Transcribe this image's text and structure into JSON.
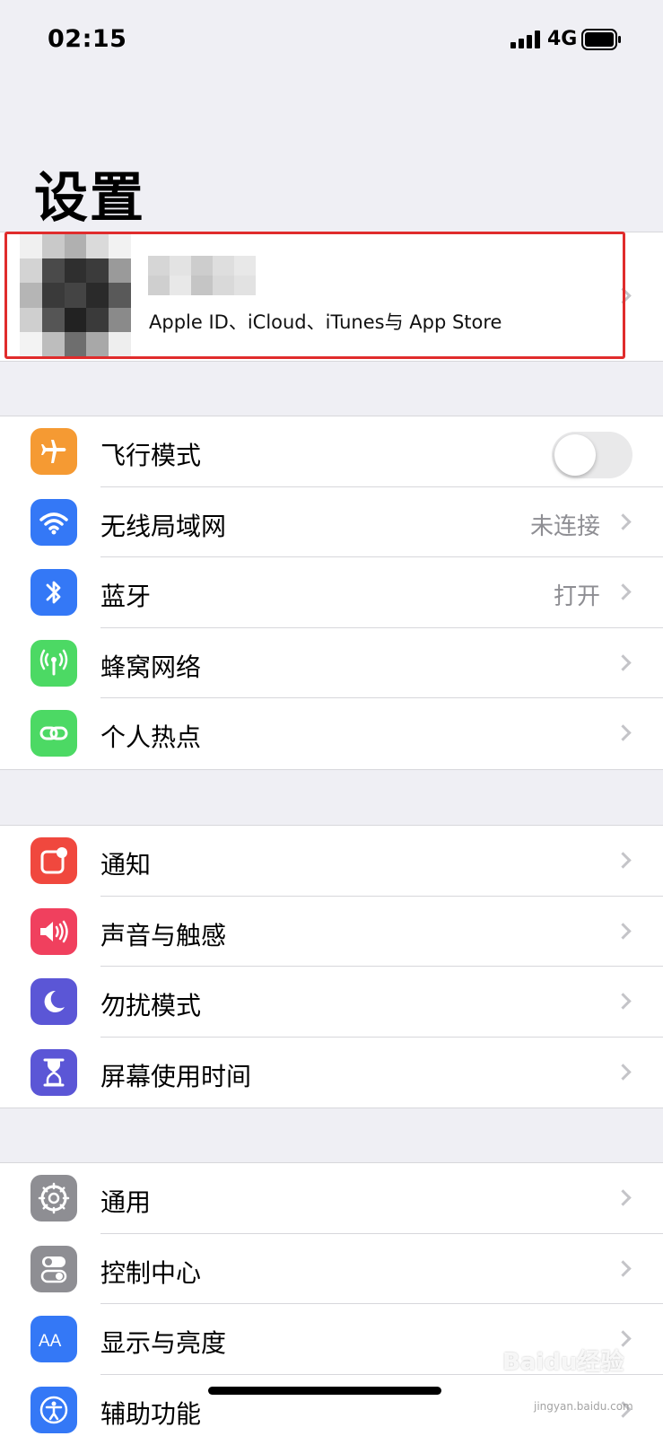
{
  "status_bar": {
    "time": "02:15",
    "network": "4G",
    "signal_icon": "signal-bars-icon",
    "battery_icon": "battery-icon"
  },
  "page": {
    "title": "设置"
  },
  "profile": {
    "subtitle": "Apple ID、iCloud、iTunes与 App Store",
    "avatar_icon": "pixelated-avatar"
  },
  "colors": {
    "highlight": "#e02c2c",
    "background": "#efeff4",
    "secondary_text": "#8e8e93"
  },
  "groups": [
    {
      "items": [
        {
          "label": "飞行模式",
          "icon": "airplane-icon",
          "icon_color": "#f59a33",
          "toggle": "off"
        },
        {
          "label": "无线局域网",
          "value": "未连接",
          "icon": "wifi-icon",
          "icon_color": "#3478f6"
        },
        {
          "label": "蓝牙",
          "value": "打开",
          "icon": "bluetooth-icon",
          "icon_color": "#3478f6"
        },
        {
          "label": "蜂窝网络",
          "icon": "cellular-icon",
          "icon_color": "#4cd964"
        },
        {
          "label": "个人热点",
          "icon": "hotspot-icon",
          "icon_color": "#4cd964"
        }
      ]
    },
    {
      "items": [
        {
          "label": "通知",
          "icon": "notifications-icon",
          "icon_color": "#f0483e"
        },
        {
          "label": "声音与触感",
          "icon": "sound-icon",
          "icon_color": "#f0405e"
        },
        {
          "label": "勿扰模式",
          "icon": "moon-icon",
          "icon_color": "#5b56d6"
        },
        {
          "label": "屏幕使用时间",
          "icon": "hourglass-icon",
          "icon_color": "#5b56d6"
        }
      ]
    },
    {
      "items": [
        {
          "label": "通用",
          "icon": "gear-icon",
          "icon_color": "#8e8e93"
        },
        {
          "label": "控制中心",
          "icon": "switches-icon",
          "icon_color": "#8e8e93"
        },
        {
          "label": "显示与亮度",
          "icon": "display-icon",
          "icon_color": "#3478f6"
        },
        {
          "label": "辅助功能",
          "icon": "accessibility-icon",
          "icon_color": "#3478f6"
        }
      ]
    }
  ],
  "watermark": {
    "brand": "Baidu经验",
    "url": "jingyan.baidu.com"
  }
}
